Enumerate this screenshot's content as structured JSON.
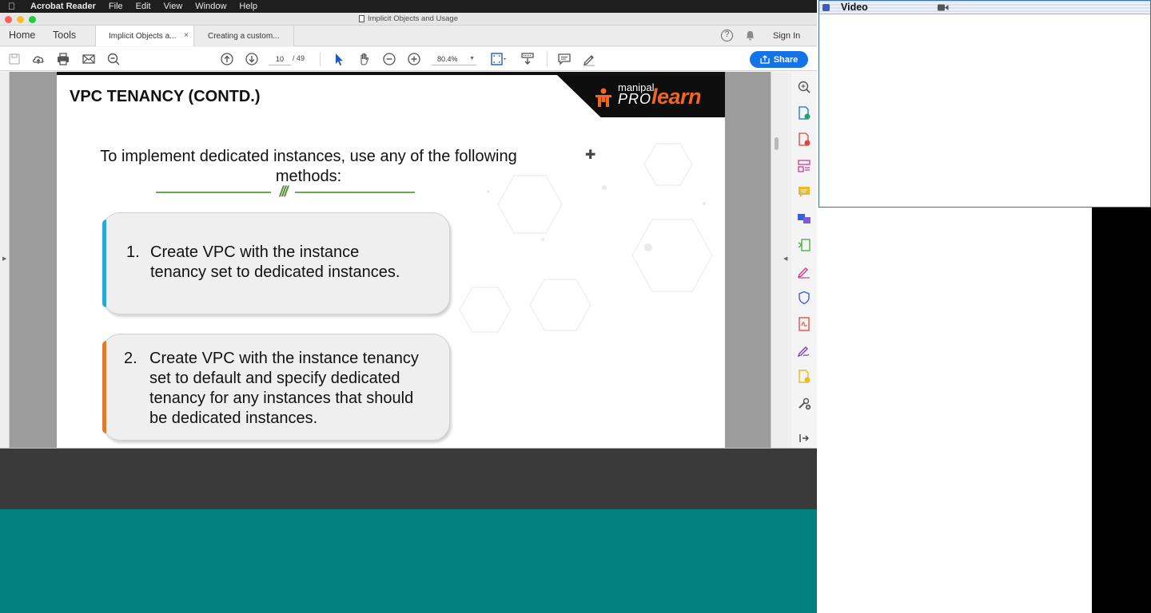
{
  "menubar": {
    "app": "Acrobat Reader",
    "items": [
      "File",
      "Edit",
      "View",
      "Window",
      "Help"
    ]
  },
  "window": {
    "title": "Implicit Objects and Usage"
  },
  "tabs": {
    "home": "Home",
    "tools": "Tools",
    "doc1": "Implicit Objects a...",
    "doc1_close": "×",
    "doc2": "Creating a custom...",
    "sign_in": "Sign In",
    "help_glyph": "?"
  },
  "toolbar": {
    "page_current": "10",
    "page_total": "/ 49",
    "zoom": "80.4%",
    "share": "Share"
  },
  "slide": {
    "title": "VPC TENANCY (CONTD.)",
    "logo_manipal": "manipal",
    "logo_pro": "PRO",
    "logo_learn": "learn",
    "intro_line1": "To implement dedicated instances, use any of the following",
    "intro_line2": "methods:",
    "divider_mark": "///",
    "item1": {
      "num": "1.",
      "lines": [
        "Create VPC with the instance",
        "tenancy set to dedicated instances."
      ]
    },
    "item2": {
      "num": "2.",
      "lines": [
        "Create VPC with the instance tenancy",
        "set to default and specify dedicated",
        "tenancy for any instances that should",
        "be dedicated instances."
      ]
    }
  },
  "video_panel": {
    "title": "Video"
  },
  "colors": {
    "share_button": "#1473e6",
    "card1_accent": "#2aa7d8",
    "card2_accent": "#e07a2e",
    "divider": "#6aa84f",
    "logo_orange": "#f26522",
    "teal_background": "#00807f"
  }
}
